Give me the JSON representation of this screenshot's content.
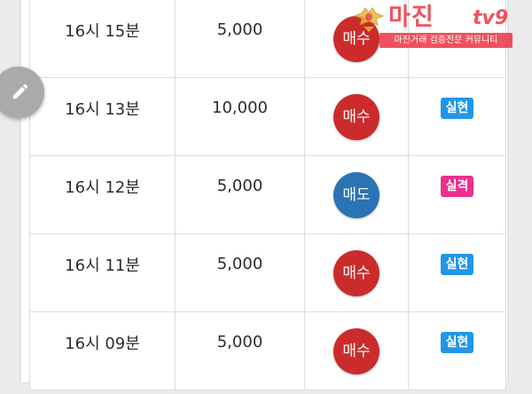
{
  "trades": [
    {
      "time": "16시 15분",
      "qty": "5,000",
      "side": "매수",
      "side_type": "buy",
      "result": "",
      "result_type": "win"
    },
    {
      "time": "16시 13분",
      "qty": "10,000",
      "side": "매수",
      "side_type": "buy",
      "result": "실현",
      "result_type": "win"
    },
    {
      "time": "16시 12분",
      "qty": "5,000",
      "side": "매도",
      "side_type": "sell",
      "result": "실격",
      "result_type": "loss"
    },
    {
      "time": "16시 11분",
      "qty": "5,000",
      "side": "매수",
      "side_type": "buy",
      "result": "실현",
      "result_type": "win"
    },
    {
      "time": "16시 09분",
      "qty": "5,000",
      "side": "매수",
      "side_type": "buy",
      "result": "실현",
      "result_type": "win"
    }
  ],
  "watermark": {
    "title": "마진",
    "suffix": "tv9",
    "tagline": "마진거래 검증전문 커뮤니티"
  },
  "edit_button": {
    "icon": "pencil-icon"
  },
  "colors": {
    "buy": "#cc2b2b",
    "sell": "#2b73b3",
    "result_win": "#2196e9",
    "result_loss": "#ec2f8f",
    "watermark": "#ee3344"
  }
}
